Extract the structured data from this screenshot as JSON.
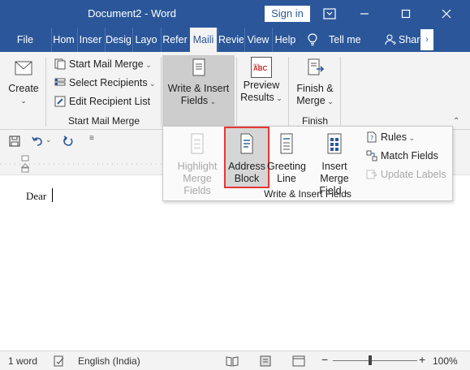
{
  "titlebar": {
    "title": "Document2 - Word",
    "signin": "Sign in"
  },
  "tabs": [
    {
      "label": "File"
    },
    {
      "label": "Hom"
    },
    {
      "label": "Inser"
    },
    {
      "label": "Desig"
    },
    {
      "label": "Layo"
    },
    {
      "label": "Refer"
    },
    {
      "label": "Maili"
    },
    {
      "label": "Revie"
    },
    {
      "label": "View"
    },
    {
      "label": "Help"
    }
  ],
  "tellme": "Tell me",
  "share": "Share",
  "ribbon": {
    "create": "Create",
    "start_mail_merge": "Start Mail Merge",
    "select_recipients": "Select Recipients",
    "edit_recipient_list": "Edit Recipient List",
    "group_start": "Start Mail Merge",
    "write_insert_line1": "Write & Insert",
    "write_insert_line2": "Fields",
    "preview_line1": "Preview",
    "preview_line2": "Results",
    "abc": "ABC",
    "finish_line1": "Finish &",
    "finish_line2": "Merge",
    "group_finish": "Finish"
  },
  "panel": {
    "highlight_line1": "Highlight",
    "highlight_line2": "Merge Fields",
    "address_line1": "Address",
    "address_line2": "Block",
    "greeting_line1": "Greeting",
    "greeting_line2": "Line",
    "insert_merge_line1": "Insert Merge",
    "insert_merge_line2": "Field",
    "rules": "Rules",
    "match_fields": "Match Fields",
    "update_labels": "Update Labels",
    "group_label": "Write & Insert Fields"
  },
  "document": {
    "text": "Dear"
  },
  "statusbar": {
    "words": "1 word",
    "language": "English (India)",
    "zoom": "100%"
  },
  "colors": {
    "accent": "#2b579a",
    "highlight_border": "#e53935",
    "ribbon_bg": "#f3f3f3"
  }
}
